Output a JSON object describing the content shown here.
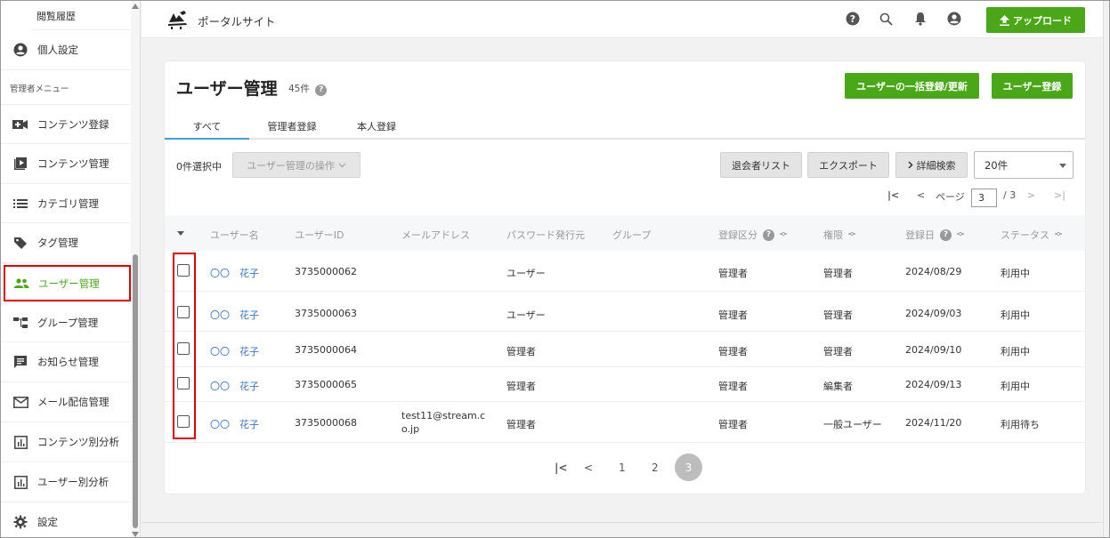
{
  "sidebar": {
    "history_label": "閲覧履歴",
    "section_label": "管理者メニュー",
    "items": [
      {
        "label": "個人設定",
        "icon": "account-circle-icon"
      },
      {
        "label": "コンテンツ登録",
        "icon": "video-add-icon"
      },
      {
        "label": "コンテンツ管理",
        "icon": "video-library-icon"
      },
      {
        "label": "カテゴリ管理",
        "icon": "list-icon"
      },
      {
        "label": "タグ管理",
        "icon": "tag-icon"
      },
      {
        "label": "ユーザー管理",
        "icon": "group-icon"
      },
      {
        "label": "グループ管理",
        "icon": "hierarchy-icon"
      },
      {
        "label": "お知らせ管理",
        "icon": "announcement-icon"
      },
      {
        "label": "メール配信管理",
        "icon": "mail-icon"
      },
      {
        "label": "コンテンツ別分析",
        "icon": "chart-icon"
      },
      {
        "label": "ユーザー別分析",
        "icon": "chart-icon"
      },
      {
        "label": "設定",
        "icon": "gear-icon"
      }
    ]
  },
  "header": {
    "site_title": "ポータルサイト",
    "upload_label": "アップロード"
  },
  "colors": {
    "accent": "#4aa818",
    "highlight": "#e00000",
    "link": "#3a78c4"
  },
  "page": {
    "title": "ユーザー管理",
    "count": "45件",
    "bulk_button": "ユーザーの一括登録/更新",
    "register_button": "ユーザー登録",
    "tabs": [
      "すべて",
      "管理者登録",
      "本人登録"
    ],
    "selected_count": "0件選択中",
    "operation_button": "ユーザー管理の操作",
    "withdrawn_button": "退会者リスト",
    "export_button": "エクスポート",
    "search_button": "詳細検索",
    "per_page": "20件",
    "page_label": "ページ",
    "page_value": "3",
    "page_total": "/ 3"
  },
  "table": {
    "columns": [
      "ユーザー名",
      "ユーザーID",
      "メールアドレス",
      "パスワード発行元",
      "グループ",
      "登録区分",
      "権限",
      "登録日",
      "ステータス"
    ],
    "rows": [
      {
        "name": "〇〇　花子",
        "id": "3735000062",
        "email": "",
        "issuer": "ユーザー",
        "group": "",
        "type": "管理者",
        "role": "管理者",
        "date": "2024/08/29",
        "status": "利用中"
      },
      {
        "name": "〇〇　花子",
        "id": "3735000063",
        "email": "",
        "issuer": "ユーザー",
        "group": "",
        "type": "管理者",
        "role": "管理者",
        "date": "2024/09/03",
        "status": "利用中"
      },
      {
        "name": "〇〇　花子",
        "id": "3735000064",
        "email": "",
        "issuer": "管理者",
        "group": "",
        "type": "管理者",
        "role": "管理者",
        "date": "2024/09/10",
        "status": "利用中"
      },
      {
        "name": "〇〇　花子",
        "id": "3735000065",
        "email": "",
        "issuer": "管理者",
        "group": "",
        "type": "管理者",
        "role": "編集者",
        "date": "2024/09/13",
        "status": "利用中"
      },
      {
        "name": "〇〇　花子",
        "id": "3735000068",
        "email": "test11@stream.co.jp",
        "email_line1": "test11@stream.c",
        "email_line2": "o.jp",
        "issuer": "管理者",
        "group": "",
        "type": "管理者",
        "role": "一般ユーザー",
        "date": "2024/11/20",
        "status": "利用待ち"
      }
    ]
  },
  "pagination": {
    "pages": [
      "1",
      "2",
      "3"
    ],
    "current": "3"
  }
}
